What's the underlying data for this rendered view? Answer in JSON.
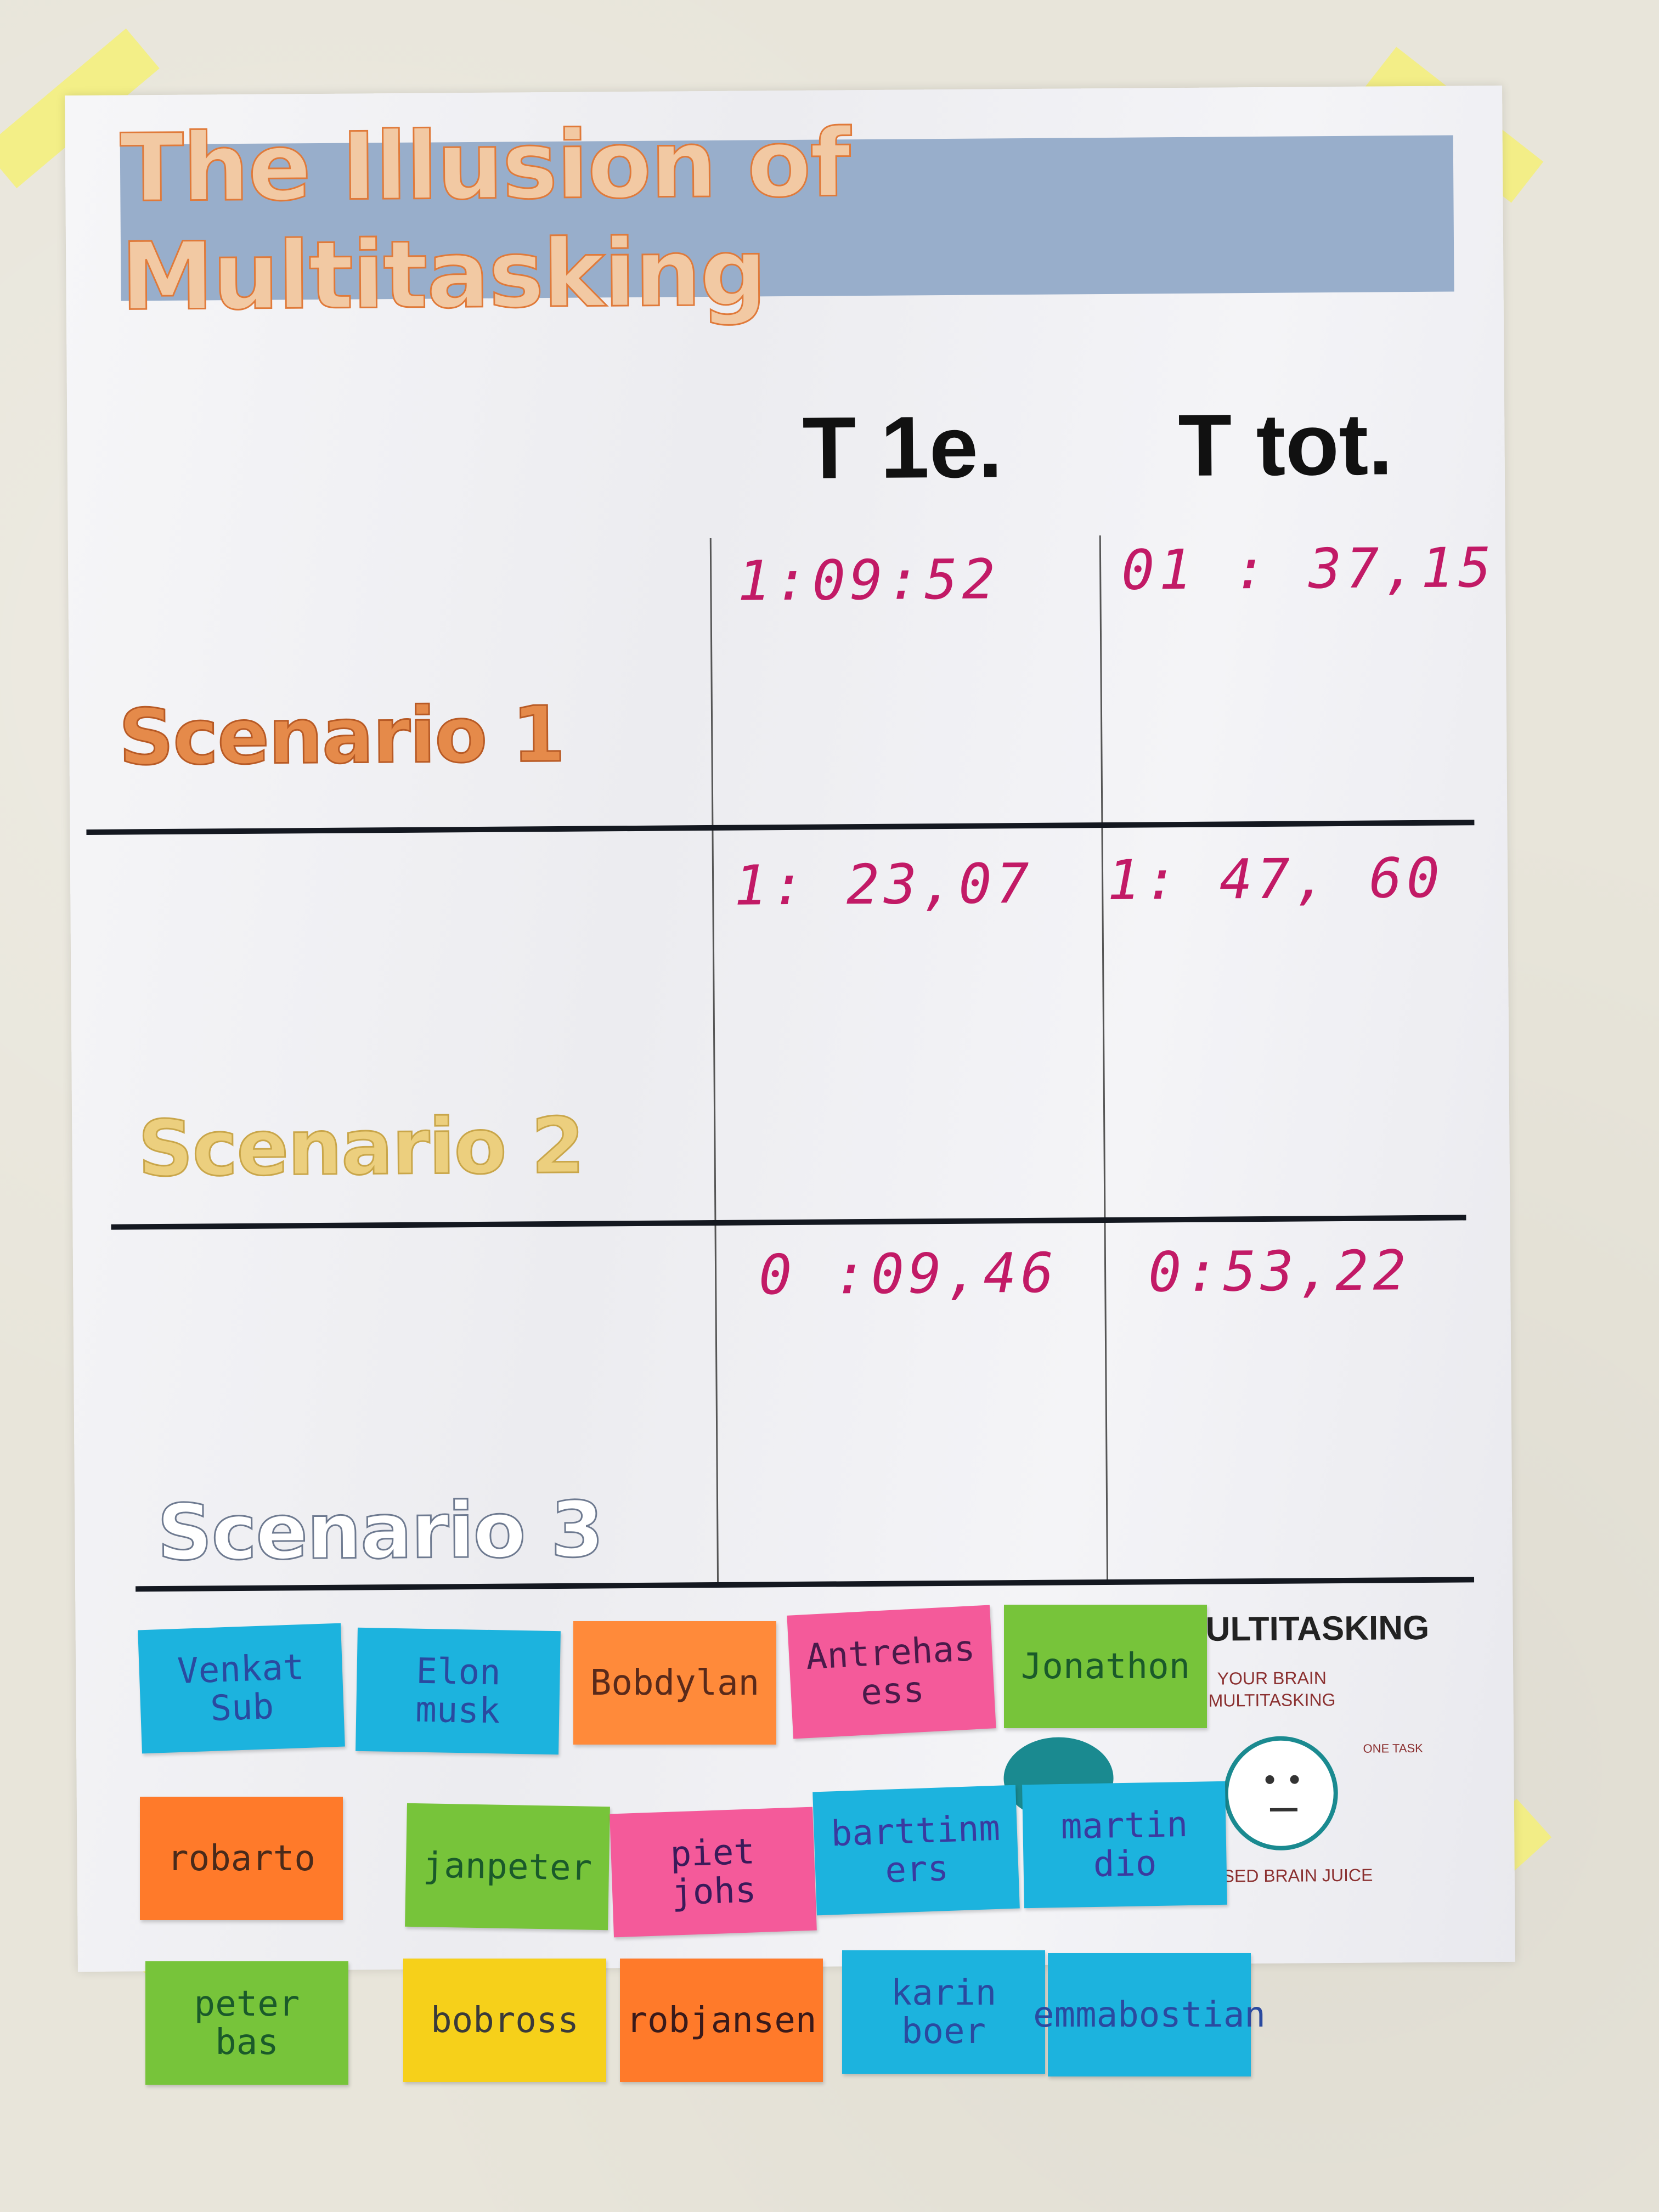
{
  "poster": {
    "title": "The Illusion of Multitasking",
    "columns": [
      "T 1e.",
      "T tot."
    ],
    "rows": [
      {
        "label": "Scenario 1",
        "t1": "1:09:52",
        "ttot": "01 : 37,15",
        "color": "#e58a4a"
      },
      {
        "label": "Scenario 2",
        "t1": "1: 23,07",
        "ttot": "1: 47, 60",
        "color": "#eccf7e"
      },
      {
        "label": "Scenario 3",
        "t1": "0 :09,46",
        "ttot": "0:53,22",
        "color": "#ffffff"
      }
    ],
    "lower_panel": {
      "heading": "ULTITASKING",
      "subheading": "YOUR BRAIN\nMULTITASKING",
      "one_task": "ONE TASK",
      "footer": "UNUSED BRAIN JUICE"
    }
  },
  "sticky_notes": [
    {
      "text": "Venkat\nSub",
      "color": "#1cb3de",
      "ink": "#2a4aa0"
    },
    {
      "text": "Elon\n  musk",
      "color": "#1cb3de",
      "ink": "#2a4aa0"
    },
    {
      "text": "Bobdylan",
      "color": "#ff8a3a",
      "ink": "#5a2a1a"
    },
    {
      "text": "Antrehas\ness",
      "color": "#f45a9a",
      "ink": "#4a1a4a"
    },
    {
      "text": "Jonathon",
      "color": "#77c43a",
      "ink": "#1a5a2a"
    },
    {
      "text": "robarto",
      "color": "#ff7a2a",
      "ink": "#4a2a1a"
    },
    {
      "text": "janpeter",
      "color": "#77c43a",
      "ink": "#1a5a2a"
    },
    {
      "text": "piet\njohs",
      "color": "#f45a9a",
      "ink": "#3a1a5a"
    },
    {
      "text": "barttinm\ners",
      "color": "#1cb3de",
      "ink": "#3a3aa0"
    },
    {
      "text": "martin\ndio",
      "color": "#1cb3de",
      "ink": "#3a3aa0"
    },
    {
      "text": "peter\nbas",
      "color": "#77c43a",
      "ink": "#1a5a2a"
    },
    {
      "text": "bobross",
      "color": "#f6d01a",
      "ink": "#3a3a3a"
    },
    {
      "text": "robjansen",
      "color": "#ff7a2a",
      "ink": "#3a1a1a"
    },
    {
      "text": "karin\nboer",
      "color": "#1cb3de",
      "ink": "#2a4aa0"
    },
    {
      "text": "emmabostian",
      "color": "#1cb3de",
      "ink": "#2a4aa0"
    }
  ]
}
